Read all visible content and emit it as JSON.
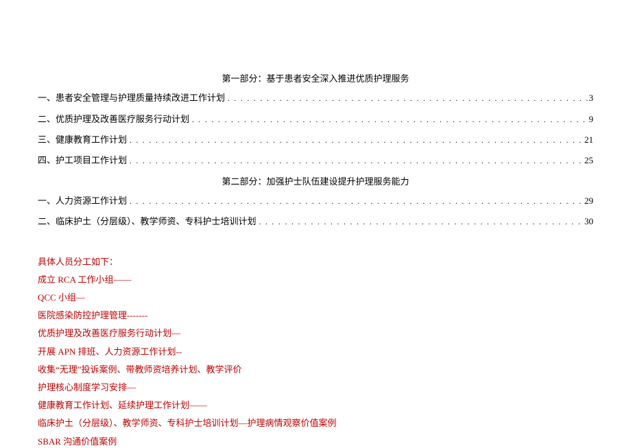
{
  "section1_title": "第一部分：基于患者安全深入推进优质护理服务",
  "toc1": [
    {
      "label": "一、患者安全管理与护理质量持续改进工作计划",
      "page": "3"
    },
    {
      "label": "二、优质护理及改善医疗服务行动计划",
      "page": "9"
    },
    {
      "label": "三、健康教育工作计划",
      "page": "21"
    },
    {
      "label": "四、护工项目工作计划",
      "page": "25"
    }
  ],
  "section2_title": "第二部分：加强护士队伍建设提升护理服务能力",
  "toc2": [
    {
      "label": "一、人力资源工作计划",
      "page": "29"
    },
    {
      "label": "二、临床护土（分层级）、教学师资、专科护士培训计划",
      "page": "30"
    }
  ],
  "assignments": {
    "title": "具体人员分工如下：",
    "lines": [
      "成立 RCA 工作小组——",
      "QCC 小组—",
      "医院感染防控护理管理-------",
      "优质护理及改善医疗服务行动计划—",
      "开展 APN 排班、人力资源工作计划--",
      "收集“无理”投诉案例、带教师资培养计划、教学评价",
      "护理核心制度学习安排—",
      "健康教育工作计划、延续护理工作计划——",
      "临床护土（分层级）、教学师资、专科护士培训计划—护理病情观察价值案例",
      "SBAR 沟通价值案例"
    ]
  }
}
